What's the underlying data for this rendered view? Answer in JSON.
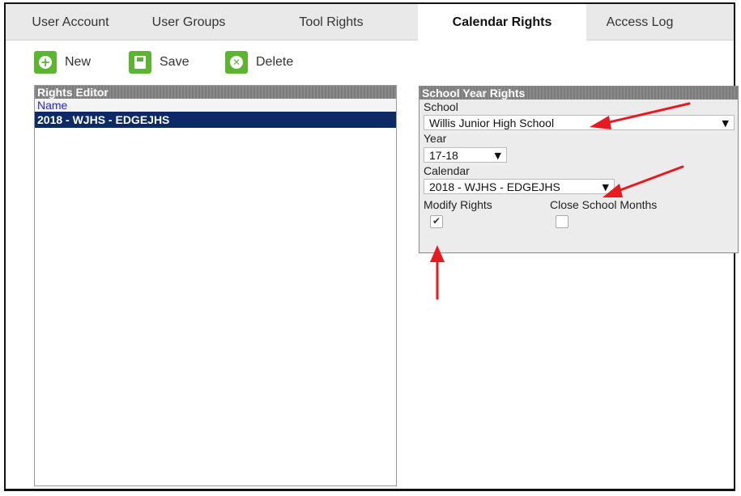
{
  "tabs": [
    {
      "label": "User Account"
    },
    {
      "label": "User Groups"
    },
    {
      "label": "Tool Rights"
    },
    {
      "label": "Calendar Rights"
    },
    {
      "label": "Access Log"
    }
  ],
  "toolbar": {
    "new_label": "New",
    "save_label": "Save",
    "delete_label": "Delete"
  },
  "rights_editor": {
    "title": "Rights Editor",
    "column": "Name",
    "rows": [
      "2018 - WJHS - EDGEJHS"
    ]
  },
  "school_year_rights": {
    "title": "School Year Rights",
    "school_label": "School",
    "school_value": "Willis Junior High School",
    "year_label": "Year",
    "year_value": "17-18",
    "calendar_label": "Calendar",
    "calendar_value": "2018 - WJHS - EDGEJHS",
    "modify_rights_label": "Modify Rights",
    "modify_rights_checked": true,
    "close_school_months_label": "Close School Months",
    "close_school_months_checked": false
  },
  "colors": {
    "accent_green": "#5cb531",
    "selection_blue": "#0b2a66",
    "annotation_red": "#e8191f"
  }
}
